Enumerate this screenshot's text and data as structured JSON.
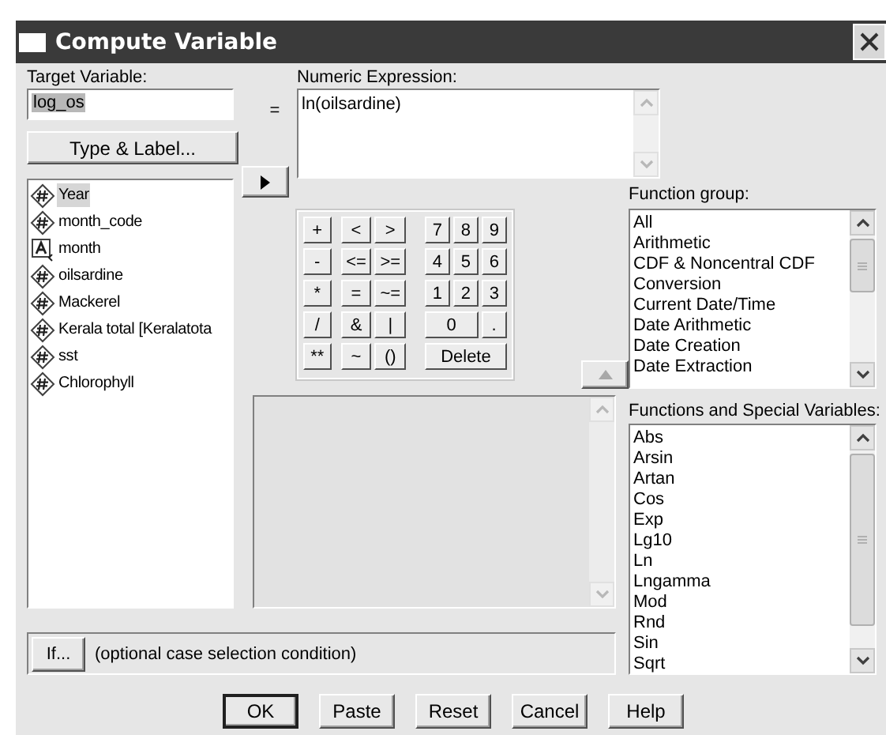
{
  "window": {
    "title": "Compute Variable"
  },
  "target_variable": {
    "label": "Target Variable:",
    "value": "log_os",
    "text_selected": true
  },
  "equals": "=",
  "numeric_expression": {
    "label": "Numeric Expression:",
    "value": "ln(oilsardine)"
  },
  "type_label_button": "Type & Label...",
  "variables": [
    {
      "name": "Year",
      "kind": "numeric",
      "selected": true
    },
    {
      "name": "month_code",
      "kind": "numeric",
      "selected": false
    },
    {
      "name": "month",
      "kind": "string",
      "selected": false
    },
    {
      "name": "oilsardine",
      "kind": "numeric",
      "selected": false
    },
    {
      "name": "Mackerel",
      "kind": "numeric",
      "selected": false
    },
    {
      "name": "Kerala total [Keralatota",
      "kind": "numeric",
      "selected": false
    },
    {
      "name": "sst",
      "kind": "numeric",
      "selected": false
    },
    {
      "name": "Chlorophyll",
      "kind": "numeric",
      "selected": false
    }
  ],
  "transfer_button": {
    "disabled": false
  },
  "keypad": [
    [
      [
        "+"
      ],
      [
        "<",
        ">"
      ],
      [
        "7",
        "8",
        "9"
      ]
    ],
    [
      [
        "-"
      ],
      [
        "<=",
        ">="
      ],
      [
        "4",
        "5",
        "6"
      ]
    ],
    [
      [
        "*"
      ],
      [
        "=",
        "~="
      ],
      [
        "1",
        "2",
        "3"
      ]
    ],
    [
      [
        "/"
      ],
      [
        "&",
        "|"
      ],
      [
        "0",
        "."
      ]
    ],
    [
      [
        "**"
      ],
      [
        "~",
        "()"
      ],
      [
        "Delete"
      ]
    ]
  ],
  "function_transfer_button": {
    "disabled": true
  },
  "function_group": {
    "label": "Function group:",
    "items": [
      {
        "label": "All",
        "selected": false
      },
      {
        "label": "Arithmetic",
        "selected": false
      },
      {
        "label": "CDF & Noncentral CDF",
        "selected": false
      },
      {
        "label": "Conversion",
        "selected": false
      },
      {
        "label": "Current Date/Time",
        "selected": false
      },
      {
        "label": "Date Arithmetic",
        "selected": false
      },
      {
        "label": "Date Creation",
        "selected": false
      },
      {
        "label": "Date Extraction",
        "selected": false
      }
    ]
  },
  "functions": {
    "label": "Functions and Special Variables:",
    "items": [
      {
        "label": "Abs",
        "selected": false
      },
      {
        "label": "Arsin",
        "selected": false
      },
      {
        "label": "Artan",
        "selected": false
      },
      {
        "label": "Cos",
        "selected": false
      },
      {
        "label": "Exp",
        "selected": false
      },
      {
        "label": "Lg10",
        "selected": false
      },
      {
        "label": "Ln",
        "selected": false
      },
      {
        "label": "Lngamma",
        "selected": false
      },
      {
        "label": "Mod",
        "selected": false
      },
      {
        "label": "Rnd",
        "selected": false
      },
      {
        "label": "Sin",
        "selected": false
      },
      {
        "label": "Sqrt",
        "selected": false
      }
    ]
  },
  "if_button": "If...",
  "condition_text": "(optional case selection condition)",
  "buttons": [
    {
      "label": "OK",
      "default": true
    },
    {
      "label": "Paste",
      "default": false
    },
    {
      "label": "Reset",
      "default": false
    },
    {
      "label": "Cancel",
      "default": false
    },
    {
      "label": "Help",
      "default": false
    }
  ]
}
